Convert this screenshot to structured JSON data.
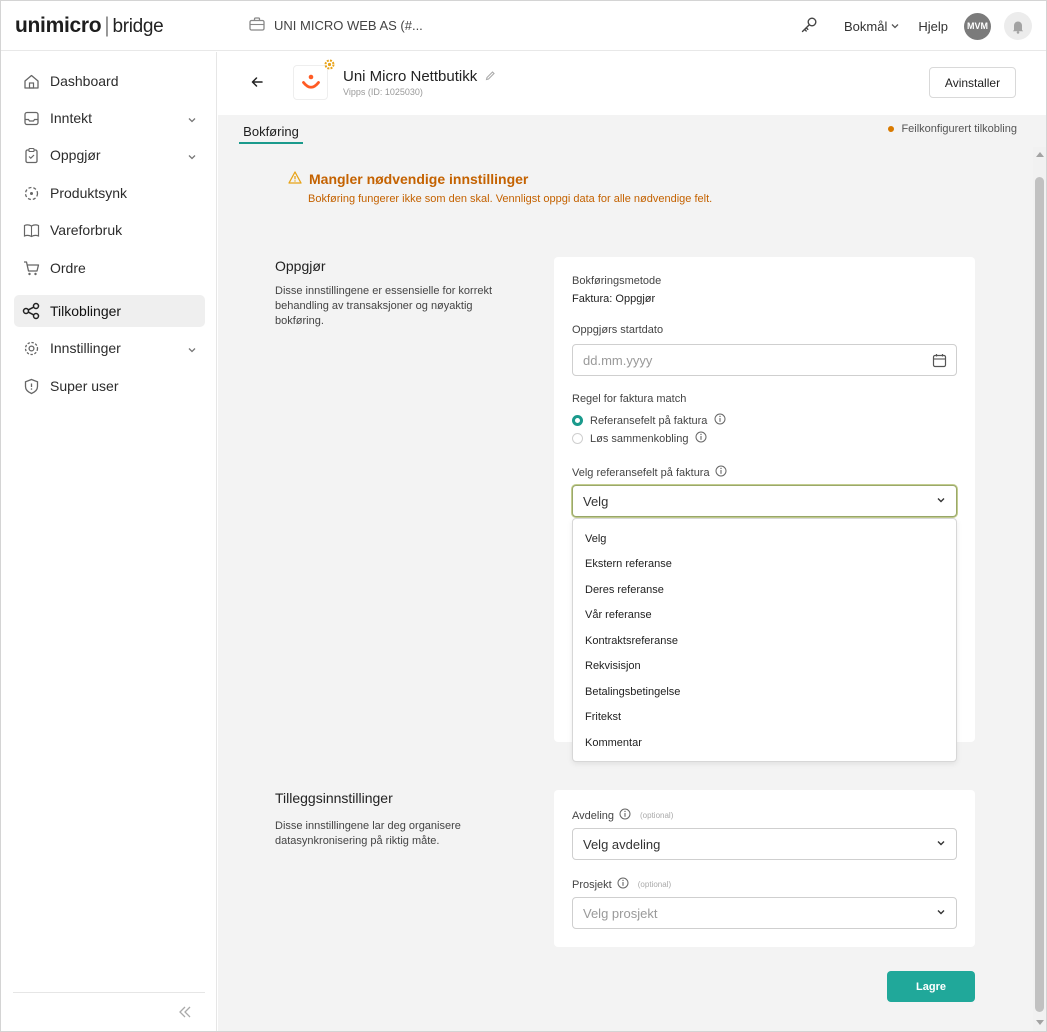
{
  "brand": {
    "logo_main": "unimicro",
    "logo_sub": "bridge"
  },
  "topbar": {
    "company": "UNI MICRO WEB AS (#...",
    "language": "Bokmål",
    "help": "Hjelp",
    "avatar_initials": "MVM"
  },
  "sidebar": {
    "items": [
      {
        "label": "Dashboard",
        "icon": "home-icon"
      },
      {
        "label": "Inntekt",
        "icon": "inbox-icon"
      },
      {
        "label": "Oppgjør",
        "icon": "clipboard-icon"
      },
      {
        "label": "Produktsynk",
        "icon": "sync-icon"
      },
      {
        "label": "Vareforbruk",
        "icon": "book-icon"
      },
      {
        "label": "Ordre",
        "icon": "cart-icon"
      },
      {
        "label": "Tilkoblinger",
        "icon": "share-icon"
      },
      {
        "label": "Innstillinger",
        "icon": "gear-icon"
      },
      {
        "label": "Super user",
        "icon": "shield-icon"
      }
    ]
  },
  "app": {
    "title": "Uni Micro Nettbutikk",
    "subtitle": "Vipps (ID: 1025030)",
    "uninstall_label": "Avinstaller",
    "tab": "Bokføring",
    "status": "Feilkonfigurert tilkobling"
  },
  "warning": {
    "title": "Mangler nødvendige innstillinger",
    "text": "Bokføring fungerer ikke som den skal. Vennligst oppgi data for alle nødvendige felt."
  },
  "settlement": {
    "title": "Oppgjør",
    "description": "Disse innstillingene er essensielle for korrekt behandling av transaksjoner og nøyaktig bokføring.",
    "method_label": "Bokføringsmetode",
    "method_value": "Faktura: Oppgjør",
    "startdate_label": "Oppgjørs startdato",
    "startdate_placeholder": "dd.mm.yyyy",
    "rule_label": "Regel for faktura match",
    "rule_options": [
      "Referansefelt på faktura",
      "Løs sammenkobling"
    ],
    "rule_selected": "Referansefelt på faktura",
    "ref_label": "Velg referansefelt på faktura",
    "ref_value": "Velg",
    "ref_options": [
      "Velg",
      "Ekstern referanse",
      "Deres referanse",
      "Vår referanse",
      "Kontraktsreferanse",
      "Rekvisisjon",
      "Betalingsbetingelse",
      "Fritekst",
      "Kommentar"
    ]
  },
  "additional": {
    "title": "Tilleggsinnstillinger",
    "description": "Disse innstillingene lar deg organisere datasynkronisering på riktig måte.",
    "department_label": "Avdeling",
    "department_optional": "(optional)",
    "department_value": "Velg avdeling",
    "project_label": "Prosjekt",
    "project_optional": "(optional)",
    "project_placeholder": "Velg prosjekt"
  },
  "save_label": "Lagre",
  "colors": {
    "accent": "#1a9a8c",
    "warning": "#c46200",
    "status_dot": "#d97a00"
  }
}
